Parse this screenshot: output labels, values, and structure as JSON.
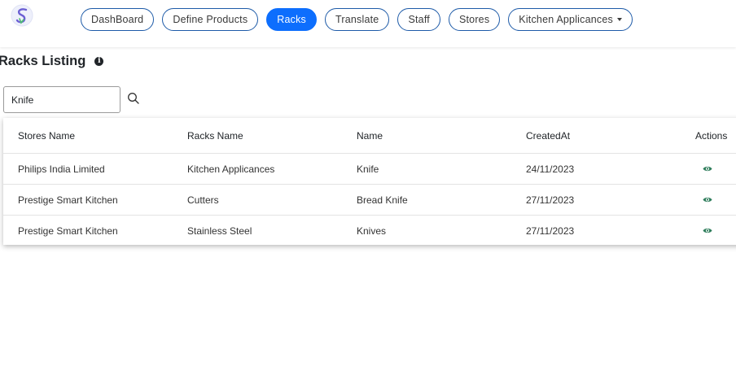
{
  "nav": {
    "items": [
      {
        "label": "DashBoard",
        "active": false
      },
      {
        "label": "Define Products",
        "active": false
      },
      {
        "label": "Racks",
        "active": true
      },
      {
        "label": "Translate",
        "active": false
      },
      {
        "label": "Staff",
        "active": false
      },
      {
        "label": "Stores",
        "active": false
      },
      {
        "label": "Kitchen Applicances",
        "active": false,
        "dropdown": true
      }
    ]
  },
  "page": {
    "title": "Racks Listing",
    "info_icon": "info-circle-icon"
  },
  "search": {
    "value": "Knife",
    "icon": "search-icon"
  },
  "table": {
    "headers": [
      "Stores Name",
      "Racks Name",
      "Name",
      "CreatedAt",
      "Actions"
    ],
    "rows": [
      {
        "store": "Philips India Limited",
        "rack": "Kitchen Applicances",
        "name": "Knife",
        "created": "24/11/2023",
        "action_icon": "eye-icon"
      },
      {
        "store": "Prestige Smart Kitchen",
        "rack": "Cutters",
        "name": "Bread Knife",
        "created": "27/11/2023",
        "action_icon": "eye-icon"
      },
      {
        "store": "Prestige Smart Kitchen",
        "rack": "Stainless Steel",
        "name": "Knives",
        "created": "27/11/2023",
        "action_icon": "eye-icon"
      }
    ]
  },
  "colors": {
    "accent": "#0d6efd",
    "pill_border": "#1e5ba8",
    "action_icon": "#2e7d5b"
  }
}
